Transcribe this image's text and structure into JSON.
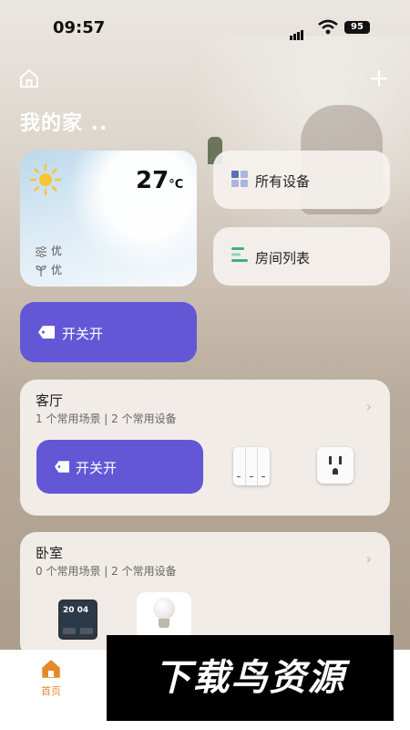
{
  "status_bar": {
    "time": "09:57",
    "battery": "95"
  },
  "header": {
    "title": "我的家 .."
  },
  "weather": {
    "temperature": "27",
    "unit": "°C",
    "air_quality": "优",
    "pollen": "优"
  },
  "quick_links": [
    {
      "label": "所有设备",
      "icon": "grid-icon"
    },
    {
      "label": "房间列表",
      "icon": "list-icon"
    }
  ],
  "scene_primary": {
    "label": "开关开"
  },
  "rooms": [
    {
      "name": "客厅",
      "summary": "1 个常用场景 | 2 个常用设备",
      "scene_label": "开关开",
      "devices": [
        "triple-switch-icon",
        "outlet-icon"
      ]
    },
    {
      "name": "卧室",
      "summary": "0 个常用场景 | 2 个常用设备",
      "devices": [
        "smart-panel-icon",
        "bulb-icon"
      ]
    }
  ],
  "panel_display": {
    "time": "20 04"
  },
  "tabbar": {
    "home_label": "首页"
  },
  "watermark": {
    "text": "下载鸟资源"
  },
  "colors": {
    "accent_scene": "#6457d6",
    "tab_active": "#e38a2d"
  }
}
